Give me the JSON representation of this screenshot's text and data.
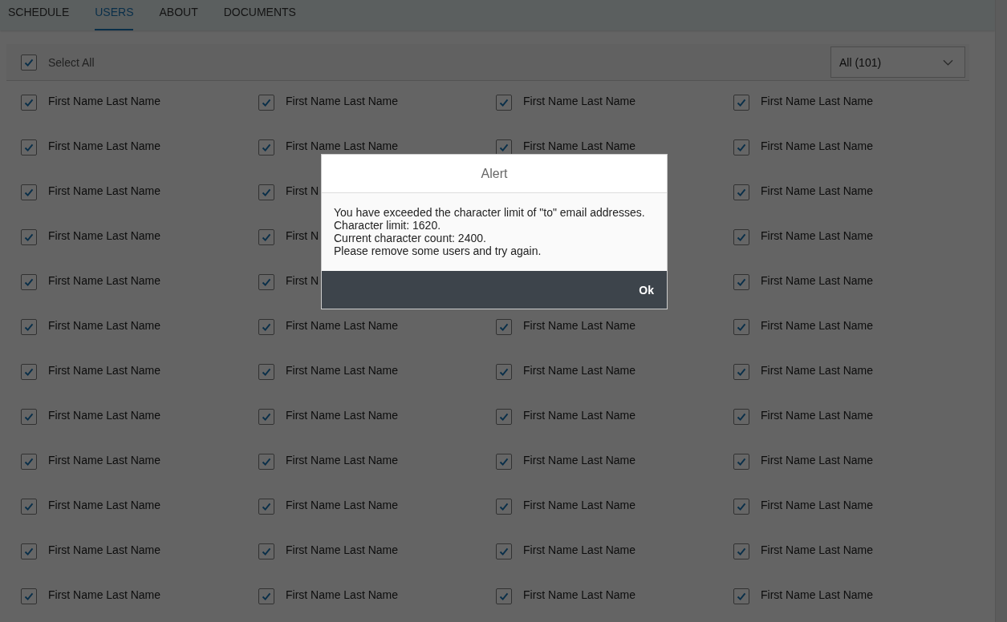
{
  "tabs": [
    {
      "label": "SCHEDULE",
      "selected": false
    },
    {
      "label": "USERS",
      "selected": true
    },
    {
      "label": "ABOUT",
      "selected": false
    },
    {
      "label": "DOCUMENTS",
      "selected": false
    }
  ],
  "select_all": {
    "label": "Select All",
    "checked": true
  },
  "filter": {
    "value": "All (101)"
  },
  "users": [
    {
      "column_1": {
        "label": "First Name Last Name",
        "checked": true
      },
      "column_2": {
        "label": "First Name Last Name",
        "checked": true
      },
      "column_3": {
        "label": "First Name Last Name",
        "checked": true
      },
      "column_4": {
        "label": "First Name Last Name",
        "checked": true
      }
    },
    {
      "column_1": {
        "label": "First Name Last Name",
        "checked": true
      },
      "column_2": {
        "label": "First Name Last Name",
        "checked": true
      },
      "column_3": {
        "label": "First Name Last Name",
        "checked": true
      },
      "column_4": {
        "label": "First Name Last Name",
        "checked": true
      }
    },
    {
      "column_1": {
        "label": "First Name Last Name",
        "checked": true
      },
      "column_2": {
        "label": "First N",
        "checked": true
      },
      "column_4": {
        "label": "First Name Last Name",
        "checked": true
      }
    },
    {
      "column_1": {
        "label": "First Name Last Name",
        "checked": true
      },
      "column_2": {
        "label": "First N",
        "checked": true
      },
      "column_4": {
        "label": "First Name Last Name",
        "checked": true
      }
    },
    {
      "column_1": {
        "label": "First Name Last Name",
        "checked": true
      },
      "column_2": {
        "label": "First N",
        "checked": true
      },
      "column_4": {
        "label": "First Name Last Name",
        "checked": true
      }
    },
    {
      "column_1": {
        "label": "First Name Last Name",
        "checked": true
      },
      "column_2": {
        "label": "First Name Last Name",
        "checked": true
      },
      "column_3": {
        "label": "First Name Last Name",
        "checked": true
      },
      "column_4": {
        "label": "First Name Last Name",
        "checked": true
      }
    },
    {
      "column_1": {
        "label": "First Name Last Name",
        "checked": true
      },
      "column_2": {
        "label": "First Name Last Name",
        "checked": true
      },
      "column_3": {
        "label": "First Name Last Name",
        "checked": true
      },
      "column_4": {
        "label": "First Name Last Name",
        "checked": true
      }
    },
    {
      "column_1": {
        "label": "First Name Last Name",
        "checked": true
      },
      "column_2": {
        "label": "First Name Last Name",
        "checked": true
      },
      "column_3": {
        "label": "First Name Last Name",
        "checked": true
      },
      "column_4": {
        "label": "First Name Last Name",
        "checked": true
      }
    },
    {
      "column_1": {
        "label": "First Name Last Name",
        "checked": true
      },
      "column_2": {
        "label": "First Name Last Name",
        "checked": true
      },
      "column_3": {
        "label": "First Name Last Name",
        "checked": true
      },
      "column_4": {
        "label": "First Name Last Name",
        "checked": true
      }
    },
    {
      "column_1": {
        "label": "First Name Last Name",
        "checked": true
      },
      "column_2": {
        "label": "First Name Last Name",
        "checked": true
      },
      "column_3": {
        "label": "First Name Last Name",
        "checked": true
      },
      "column_4": {
        "label": "First Name Last Name",
        "checked": true
      }
    },
    {
      "column_1": {
        "label": "First Name Last Name",
        "checked": true
      },
      "column_2": {
        "label": "First Name Last Name",
        "checked": true
      },
      "column_3": {
        "label": "First Name Last Name",
        "checked": true
      },
      "column_4": {
        "label": "First Name Last Name",
        "checked": true
      }
    },
    {
      "column_1": {
        "label": "First Name Last Name",
        "checked": true
      },
      "column_2": {
        "label": "First Name Last Name",
        "checked": true
      },
      "column_3": {
        "label": "First Name Last Name",
        "checked": true
      },
      "column_4": {
        "label": "First Name Last Name",
        "checked": true
      }
    }
  ],
  "dialog": {
    "title": "Alert",
    "message": [
      "You have exceeded the character limit of \"to\" email addresses.",
      "Character limit: 1620.",
      "Current character count: 2400.",
      "Please remove some users and try again."
    ],
    "button": "Ok"
  }
}
